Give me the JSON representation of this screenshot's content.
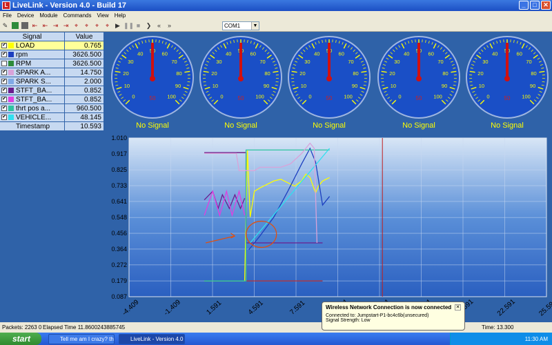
{
  "window": {
    "title": "LiveLink - Version 4.0 - Build 17",
    "app_icon_letter": "L"
  },
  "menu": [
    "File",
    "Device",
    "Module",
    "Commands",
    "View",
    "Help"
  ],
  "toolbar": {
    "glyphs": [
      "✎",
      "■",
      "■",
      "⇤",
      "⇤",
      "⇥",
      "⇥",
      "⌖",
      "⌖",
      "⌖",
      "⌖",
      "▶",
      "❚❚",
      "■",
      "❯",
      "«",
      "»"
    ],
    "com_port": "COM1"
  },
  "signals": {
    "header_signal": "Signal",
    "header_value": "Value",
    "rows": [
      {
        "name": "LOAD",
        "value": "0.765",
        "checked": "✔",
        "color": "#ffff00",
        "selected": true
      },
      {
        "name": "rpm",
        "value": "3626.500",
        "checked": "✔",
        "color": "#1c3fbf"
      },
      {
        "name": "RPM",
        "value": "3626.500",
        "checked": "",
        "color": "#2e8b3a"
      },
      {
        "name": "SPARK A...",
        "value": "14.750",
        "checked": "✔",
        "color": "#d9a3d9"
      },
      {
        "name": "SPARK S...",
        "value": "2.000",
        "checked": "✔",
        "color": "#7fa9e6"
      },
      {
        "name": "STFT_BA...",
        "value": "0.852",
        "checked": "✔",
        "color": "#6b1c8e"
      },
      {
        "name": "STFT_BA...",
        "value": "0.852",
        "checked": "✔",
        "color": "#e040e0"
      },
      {
        "name": "thrt pos a...",
        "value": "960.500",
        "checked": "✔",
        "color": "#2ec4a0"
      },
      {
        "name": "VEHICLE...",
        "value": "48.145",
        "checked": "✔",
        "color": "#30e0f0"
      }
    ],
    "timestamp_label": "Timestamp",
    "timestamp_value": "10.593"
  },
  "gauges": {
    "tick_labels": [
      "0",
      "10",
      "20",
      "30",
      "40",
      "50",
      "60",
      "70",
      "80",
      "90",
      "100"
    ],
    "center_label": "50",
    "status": [
      "No Signal",
      "No Signal",
      "No Signal",
      "No Signal",
      "No Signal"
    ]
  },
  "chart_data": {
    "type": "line",
    "y_ticks": [
      "1.010",
      "0.917",
      "0.825",
      "0.733",
      "0.641",
      "0.548",
      "0.456",
      "0.364",
      "0.272",
      "0.179",
      "0.087"
    ],
    "x_ticks": [
      "-4.409",
      "-1.409",
      "1.591",
      "4.591",
      "7.591",
      "10.591",
      "13.591",
      "16.591",
      "19.591",
      "22.591",
      "25.591"
    ],
    "ylim": [
      0.087,
      1.01
    ],
    "xlim": [
      -4.409,
      25.591
    ],
    "cursor_x": 13.8,
    "series": [
      {
        "color": "#c03030",
        "points": [
          [
            1.0,
            0.925
          ],
          [
            4.0,
            0.925
          ],
          [
            4.0,
            0.179
          ],
          [
            9.5,
            0.179
          ]
        ]
      },
      {
        "color": "#6b1c8e",
        "points": [
          [
            1.0,
            0.925
          ],
          [
            4.0,
            0.925
          ],
          [
            4.0,
            0.4
          ],
          [
            9.5,
            0.4
          ]
        ]
      },
      {
        "color": "#ffff00",
        "points": [
          [
            1.0,
            0.179
          ],
          [
            3.9,
            0.179
          ],
          [
            4.1,
            0.94
          ],
          [
            4.3,
            0.55
          ],
          [
            4.6,
            0.7
          ],
          [
            5.0,
            0.72
          ],
          [
            5.5,
            0.74
          ],
          [
            6.0,
            0.76
          ],
          [
            6.5,
            0.77
          ],
          [
            7.0,
            0.75
          ],
          [
            7.5,
            0.73
          ],
          [
            8.0,
            0.76
          ],
          [
            8.3,
            0.8
          ],
          [
            8.6,
            0.78
          ],
          [
            9.0,
            0.69
          ],
          [
            9.2,
            0.73
          ],
          [
            9.5,
            0.76
          ],
          [
            10.0,
            0.78
          ]
        ]
      },
      {
        "color": "#1c3fbf",
        "points": [
          [
            4.2,
            0.36
          ],
          [
            5.0,
            0.44
          ],
          [
            6.0,
            0.55
          ],
          [
            7.0,
            0.7
          ],
          [
            8.0,
            0.86
          ],
          [
            8.6,
            0.95
          ],
          [
            9.0,
            0.87
          ],
          [
            9.5,
            0.62
          ],
          [
            10.0,
            0.67
          ]
        ]
      },
      {
        "color": "#2ec4a0",
        "points": [
          [
            1.0,
            0.179
          ],
          [
            4.0,
            0.179
          ],
          [
            4.0,
            0.94
          ],
          [
            10.0,
            0.94
          ]
        ]
      },
      {
        "color": "#30e0f0",
        "points": [
          [
            4.3,
            0.4
          ],
          [
            10.0,
            0.95
          ]
        ]
      },
      {
        "color": "#d9a3d9",
        "points": [
          [
            1.0,
            0.92
          ],
          [
            3.3,
            0.92
          ],
          [
            3.5,
            0.82
          ],
          [
            4.6,
            0.82
          ],
          [
            5.0,
            0.84
          ],
          [
            6.5,
            0.84
          ],
          [
            7.2,
            0.86
          ],
          [
            8.0,
            0.92
          ],
          [
            8.6,
            0.98
          ],
          [
            8.9,
            0.95
          ],
          [
            9.1,
            0.4
          ]
        ]
      },
      {
        "color": "#6b1c8e",
        "points": [
          [
            1.0,
            0.65
          ],
          [
            1.6,
            0.7
          ],
          [
            2.0,
            0.6
          ],
          [
            2.3,
            0.68
          ],
          [
            2.8,
            0.6
          ],
          [
            3.2,
            0.68
          ],
          [
            3.6,
            0.6
          ],
          [
            3.9,
            0.66
          ]
        ]
      },
      {
        "color": "#e040e0",
        "points": [
          [
            1.0,
            0.56
          ],
          [
            1.6,
            0.7
          ],
          [
            2.1,
            0.56
          ],
          [
            2.6,
            0.7
          ],
          [
            3.0,
            0.56
          ],
          [
            3.5,
            0.7
          ],
          [
            3.9,
            0.56
          ]
        ]
      }
    ],
    "annotation": {
      "arrow_color": "#e05010",
      "circle_color": "#e05010"
    }
  },
  "status": {
    "packets": "Packets: 2263 0",
    "elapsed": "Elapsed Time 11.8600243885745",
    "time": "Time: 13.300"
  },
  "balloon": {
    "title": "Wireless Network Connection is now connected",
    "line1": "Connected to: Jumpstart-P1-bc4c6b(unsecured)",
    "line2": "Signal Strength: Low",
    "close": "✕"
  },
  "taskbar": {
    "start": "start",
    "tasks": [
      "Tell me am I crazy? th...",
      "LiveLink - Version 4.0 ..."
    ],
    "clock": "11:30 AM"
  }
}
